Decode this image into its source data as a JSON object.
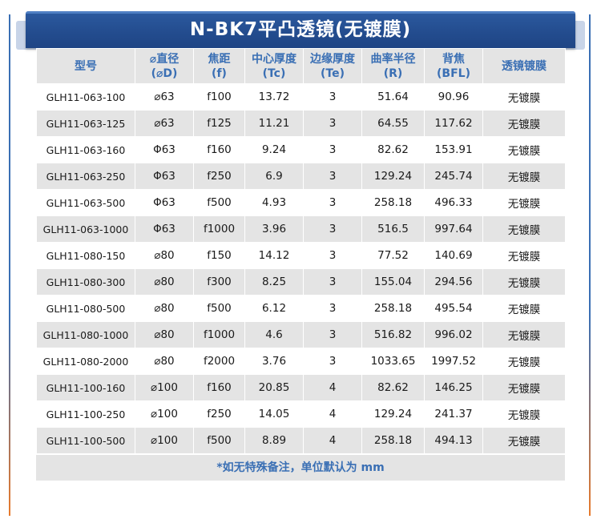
{
  "title": "N-BK7平凸透镜(无镀膜)",
  "headers": [
    {
      "line1": "型号",
      "line2": ""
    },
    {
      "line1": "⌀直径",
      "line2": "(⌀D)"
    },
    {
      "line1": "焦距",
      "line2": "(f)"
    },
    {
      "line1": "中心厚度",
      "line2": "(Tc)"
    },
    {
      "line1": "边缘厚度",
      "line2": "(Te)"
    },
    {
      "line1": "曲率半径",
      "line2": "(R)"
    },
    {
      "line1": "背焦",
      "line2": "(BFL)"
    },
    {
      "line1": "透镜镀膜",
      "line2": ""
    }
  ],
  "rows": [
    [
      "GLH11-063-100",
      "⌀63",
      "f100",
      "13.72",
      "3",
      "51.64",
      "90.96",
      "无镀膜"
    ],
    [
      "GLH11-063-125",
      "⌀63",
      "f125",
      "11.21",
      "3",
      "64.55",
      "117.62",
      "无镀膜"
    ],
    [
      "GLH11-063-160",
      "Φ63",
      "f160",
      "9.24",
      "3",
      "82.62",
      "153.91",
      "无镀膜"
    ],
    [
      "GLH11-063-250",
      "Φ63",
      "f250",
      "6.9",
      "3",
      "129.24",
      "245.74",
      "无镀膜"
    ],
    [
      "GLH11-063-500",
      "Φ63",
      "f500",
      "4.93",
      "3",
      "258.18",
      "496.33",
      "无镀膜"
    ],
    [
      "GLH11-063-1000",
      "Φ63",
      "f1000",
      "3.96",
      "3",
      "516.5",
      "997.64",
      "无镀膜"
    ],
    [
      "GLH11-080-150",
      "⌀80",
      "f150",
      "14.12",
      "3",
      "77.52",
      "140.69",
      "无镀膜"
    ],
    [
      "GLH11-080-300",
      "⌀80",
      "f300",
      "8.25",
      "3",
      "155.04",
      "294.56",
      "无镀膜"
    ],
    [
      "GLH11-080-500",
      "⌀80",
      "f500",
      "6.12",
      "3",
      "258.18",
      "495.54",
      "无镀膜"
    ],
    [
      "GLH11-080-1000",
      "⌀80",
      "f1000",
      "4.6",
      "3",
      "516.82",
      "996.02",
      "无镀膜"
    ],
    [
      "GLH11-080-2000",
      "⌀80",
      "f2000",
      "3.76",
      "3",
      "1033.65",
      "1997.52",
      "无镀膜"
    ],
    [
      "GLH11-100-160",
      "⌀100",
      "f160",
      "20.85",
      "4",
      "82.62",
      "146.25",
      "无镀膜"
    ],
    [
      "GLH11-100-250",
      "⌀100",
      "f250",
      "14.05",
      "4",
      "129.24",
      "241.37",
      "无镀膜"
    ],
    [
      "GLH11-100-500",
      "⌀100",
      "f500",
      "8.89",
      "4",
      "258.18",
      "494.13",
      "无镀膜"
    ]
  ],
  "note": "*如无特殊备注，单位默认为 mm",
  "colors": {
    "banner": "#2c5aa0",
    "header_text": "#3a6fb4",
    "stripe": "#e4e4e4",
    "accent_orange": "#e87a2c"
  }
}
